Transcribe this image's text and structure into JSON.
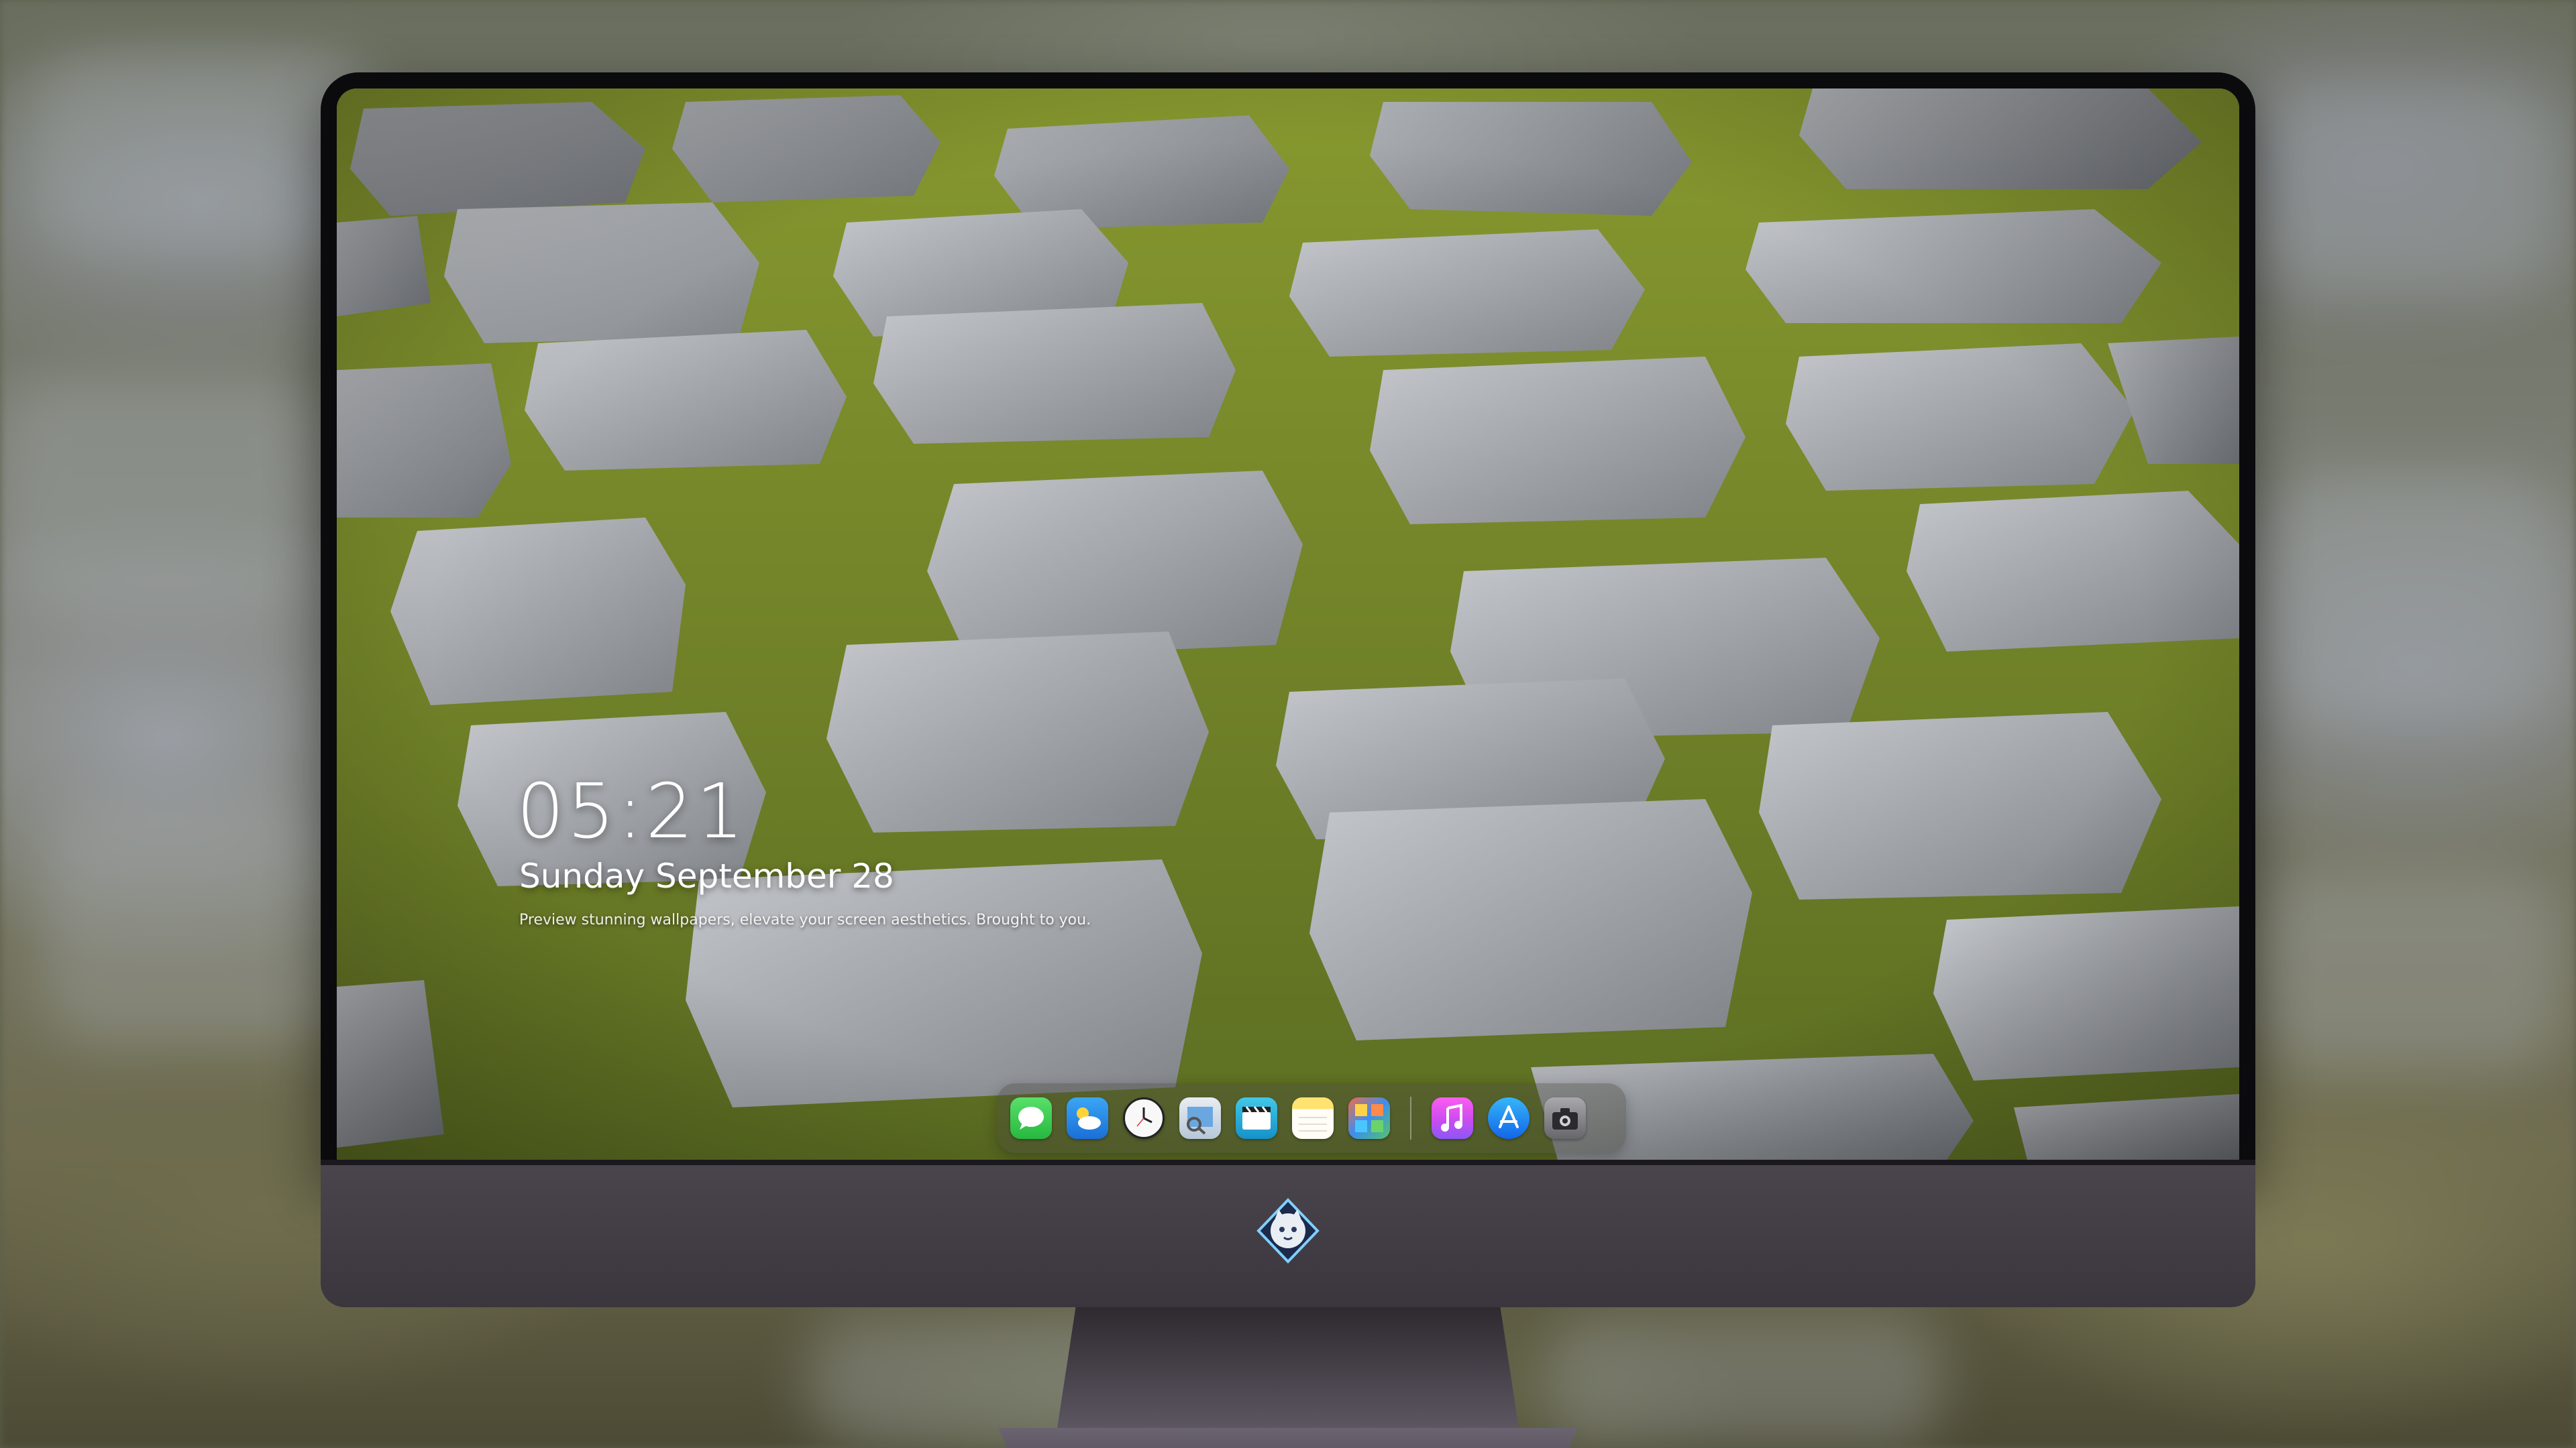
{
  "lockscreen": {
    "time": "05:21",
    "date": "Sunday September 28",
    "caption": "Preview stunning wallpapers, elevate your screen aesthetics. Brought to you."
  },
  "dock": {
    "apps": [
      {
        "name": "Messages",
        "icon": "messages-icon"
      },
      {
        "name": "Weather",
        "icon": "weather-icon"
      },
      {
        "name": "Clock",
        "icon": "clock-icon"
      },
      {
        "name": "Preview",
        "icon": "preview-icon"
      },
      {
        "name": "Clips",
        "icon": "clips-icon"
      },
      {
        "name": "Notes",
        "icon": "notes-icon"
      },
      {
        "name": "Photo Booth",
        "icon": "photo-booth-icon"
      },
      {
        "name": "Music",
        "icon": "music-icon"
      },
      {
        "name": "App Store",
        "icon": "app-store-icon"
      },
      {
        "name": "Camera",
        "icon": "camera-icon"
      }
    ]
  },
  "monitor": {
    "logo": "cat-mascot-logo",
    "bezel_color": "#0b0b0d",
    "chin_color": "#423d45"
  },
  "wallpaper": {
    "stone_color": "#a3a7ac",
    "moss_color": "#7c8c2c"
  }
}
